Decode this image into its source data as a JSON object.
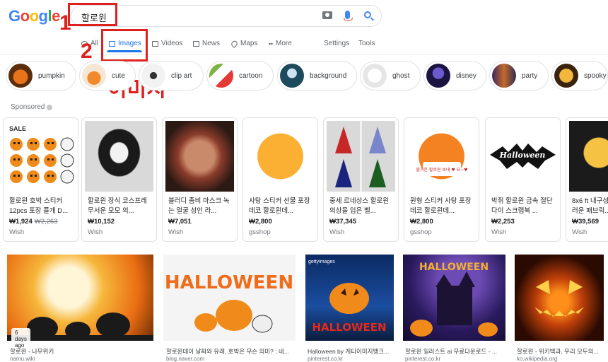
{
  "logo": [
    "G",
    "o",
    "o",
    "g",
    "l",
    "e"
  ],
  "search": {
    "query": "할로윈"
  },
  "annotations": {
    "step1": "1",
    "step2": "2",
    "label": "이미지"
  },
  "tabs": [
    {
      "label": "All",
      "active": false
    },
    {
      "label": "Images",
      "active": true
    },
    {
      "label": "Videos",
      "active": false
    },
    {
      "label": "News",
      "active": false
    },
    {
      "label": "Maps",
      "active": false
    },
    {
      "label": "More",
      "active": false
    }
  ],
  "tools": {
    "settings": "Settings",
    "tools": "Tools"
  },
  "chips": [
    "pumpkin",
    "cute",
    "clip art",
    "cartoon",
    "background",
    "ghost",
    "disney",
    "party",
    "spooky"
  ],
  "sponsored_label": "Sponsored",
  "shopping": [
    {
      "title": "할로윈 호박 스티커 12pcs 포장 플개 D...",
      "price": "₩1,924",
      "old_price": "₩2,263",
      "store": "Wish",
      "badge": "SALE"
    },
    {
      "title": "할로윈 장식 코스프레 무서운 모모 의...",
      "price": "₩10,152",
      "old_price": "",
      "store": "Wish"
    },
    {
      "title": "블러디 좀비 마스크 녹는 얼굴 성인 라...",
      "price": "₩7,051",
      "old_price": "",
      "store": "Wish"
    },
    {
      "title": "사탕 스티커 선물 포장 데코 할로윈데...",
      "price": "₩2,800",
      "old_price": "",
      "store": "gsshop"
    },
    {
      "title": "중세 르네상스 할로윈 의상을 입은 벨...",
      "price": "₩37,345",
      "old_price": "",
      "store": "Wish"
    },
    {
      "title": "원형 스티커 사탕 포장 데코 할로윈데...",
      "price": "₩2,800",
      "old_price": "",
      "store": "gsshop"
    },
    {
      "title": "박쥐 할로윈 금속 절단 다이 스크랩북 ...",
      "price": "₩2,253",
      "old_price": "",
      "store": "Wish"
    },
    {
      "title": "8x6 ft 내구성 러운 패브릭...",
      "price": "₩39,569",
      "old_price": "",
      "store": "Wish"
    }
  ],
  "results": [
    {
      "title": "할로윈 - 나무위키",
      "source": "namu.wiki",
      "ago": "6 days ago"
    },
    {
      "title": "할로윈데이 날짜와 유래, 호박은 무슨 의미? : 네...",
      "source": "blog.naver.com"
    },
    {
      "title": "Halloween by 게티이미지뱅크...",
      "source": "pinterest.co.kr",
      "watermark": "gettyimages"
    },
    {
      "title": "할로윈 일러스트 ai 무료다운로드 - ...",
      "source": "pinterest.co.kr"
    },
    {
      "title": "할로윈 - 위키백과, 우리 모두의...",
      "source": "ko.wikipedia.org"
    }
  ],
  "image_texts": {
    "halloween1": "HALLOWEEN",
    "halloween2": "HALLOWEEN",
    "halloween3": "HALLOWEEN",
    "bat_text": "Halloween",
    "sticker_text": "즐거운 할로윈 보내 ♥ 요~♥"
  },
  "colors": {
    "accent": "#1a73e8",
    "annotation": "#e0201c"
  }
}
